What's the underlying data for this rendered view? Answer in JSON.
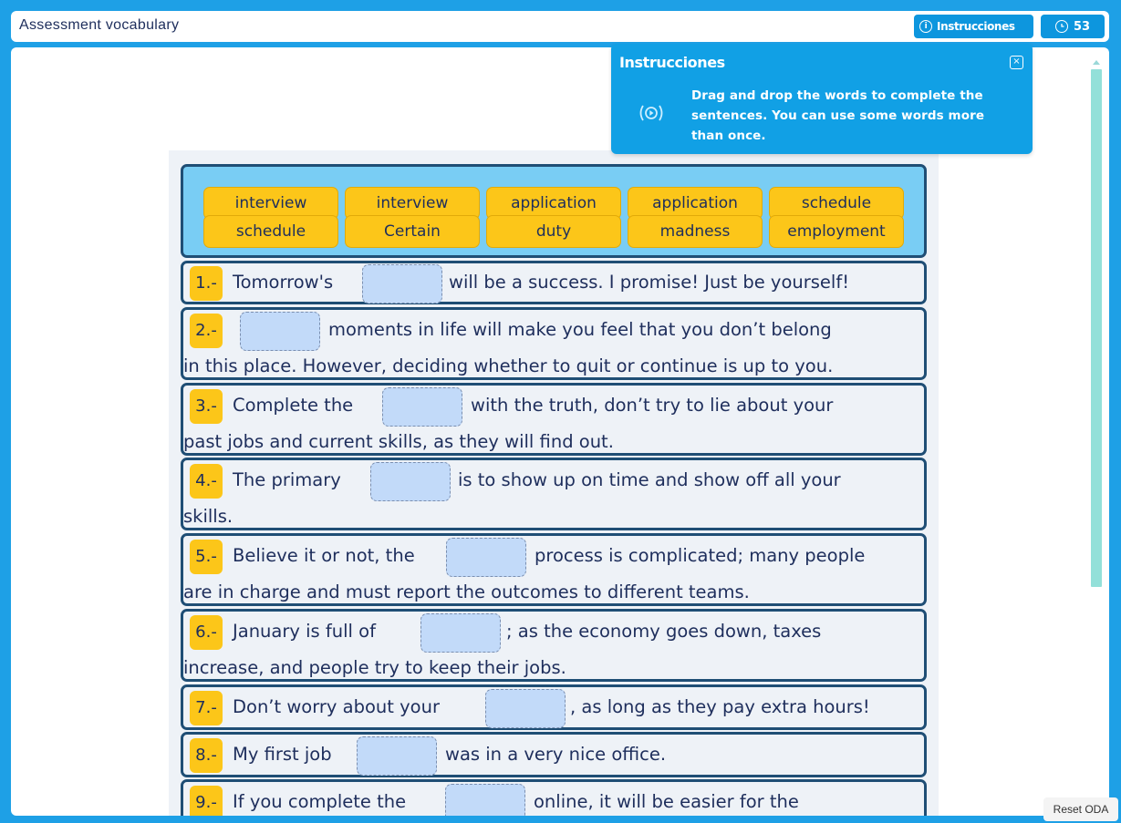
{
  "app": {
    "title": "Assessment vocabulary",
    "instructions_button": "Instrucciones",
    "timer": "53",
    "reset_button": "Reset ODA"
  },
  "popup": {
    "title": "Instrucciones",
    "close_icon": "×",
    "text": "Drag and drop the words to complete the sentences. You can use some words more than once."
  },
  "word_bank": [
    "interview",
    "interview",
    "application",
    "application",
    "schedule",
    "schedule",
    "Certain",
    "duty",
    "madness",
    "employment"
  ],
  "questions": [
    {
      "number": "1.-",
      "pre": "Tomorrow's",
      "post": "will be a success. I promise! Just be yourself!",
      "line2": ""
    },
    {
      "number": "2.-",
      "pre": "",
      "post": "moments in life will make you feel that you don’t belong",
      "line2": "in this place. However, deciding whether to quit or continue is up to you."
    },
    {
      "number": "3.-",
      "pre": "Complete the",
      "post": "with the truth, don’t try to lie about your",
      "line2": "past jobs and current skills, as they will find out."
    },
    {
      "number": "4.-",
      "pre": "The primary",
      "post": "is to show up on time and show off all your",
      "line2": "skills."
    },
    {
      "number": "5.-",
      "pre": "Believe it or not, the",
      "post": "process is complicated; many people",
      "line2": "are in charge and must report the outcomes to different teams."
    },
    {
      "number": "6.-",
      "pre": "January is full of",
      "post": "; as the economy goes down, taxes",
      "line2": "increase, and people try to keep their jobs."
    },
    {
      "number": "7.-",
      "pre": "Don’t worry about your",
      "post": ", as long as they pay extra hours!",
      "line2": ""
    },
    {
      "number": "8.-",
      "pre": "My first job",
      "post": "was in a very nice office.",
      "line2": ""
    },
    {
      "number": "9.-",
      "pre": "If you complete the",
      "post": "online, it will be easier for the",
      "line2": ""
    }
  ]
}
